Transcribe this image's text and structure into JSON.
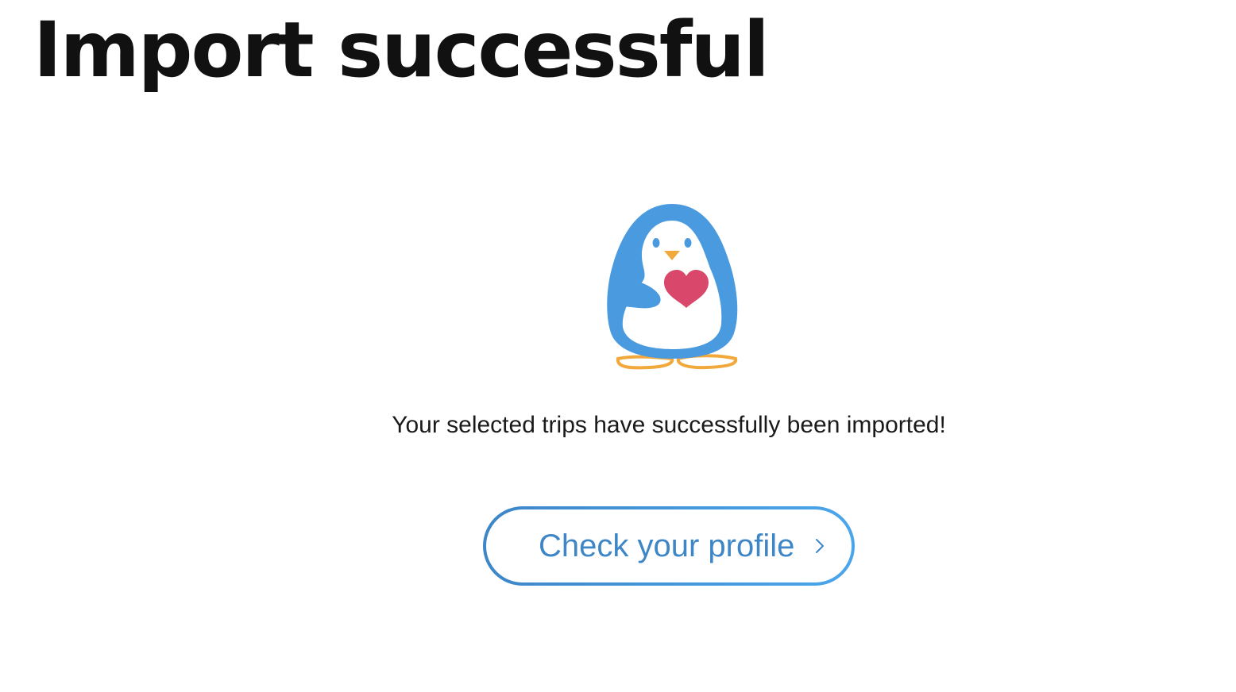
{
  "page": {
    "title": "Import successful",
    "message": "Your selected trips have successfully been imported!"
  },
  "mascot": {
    "icon": "penguin-heart-icon",
    "colors": {
      "body": "#4a9ae0",
      "belly": "#ffffff",
      "heart": "#d9486b",
      "beak": "#f0a93a",
      "feet": "#f0a93a",
      "eyes": "#4a9ae0"
    }
  },
  "cta": {
    "label": "Check your profile",
    "icon": "chevron-right-icon",
    "gradient_start": "#3d86c8",
    "gradient_end": "#4aa6ec",
    "text_color": "#3e86c6"
  }
}
